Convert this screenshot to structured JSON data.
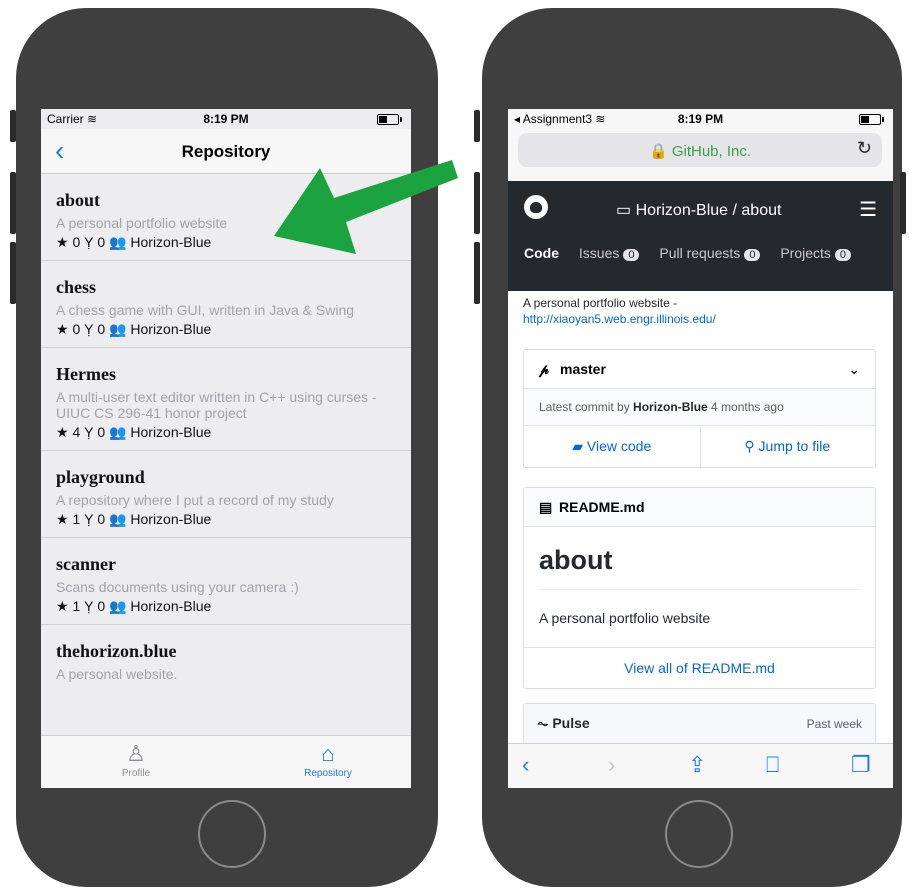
{
  "left": {
    "status": {
      "carrier": "Carrier",
      "time": "8:19 PM"
    },
    "nav": {
      "back": "‹",
      "title": "Repository"
    },
    "repos": [
      {
        "name": "about",
        "desc": "A personal portfolio website",
        "stars": "0",
        "forks": "0",
        "owner": "Horizon-Blue"
      },
      {
        "name": "chess",
        "desc": "A chess game with GUI, written in Java & Swing",
        "stars": "0",
        "forks": "0",
        "owner": "Horizon-Blue"
      },
      {
        "name": "Hermes",
        "desc": "A multi-user text editor written in C++ using curses - UIUC CS 296-41 honor project",
        "stars": "4",
        "forks": "0",
        "owner": "Horizon-Blue"
      },
      {
        "name": "playground",
        "desc": "A repository where I put a record of my study",
        "stars": "1",
        "forks": "0",
        "owner": "Horizon-Blue"
      },
      {
        "name": "scanner",
        "desc": "Scans documents using your camera :)",
        "stars": "1",
        "forks": "0",
        "owner": "Horizon-Blue"
      },
      {
        "name": "thehorizon.blue",
        "desc": "A personal website.",
        "stars": "",
        "forks": "",
        "owner": ""
      }
    ],
    "tabs": {
      "profile": "Profile",
      "repository": "Repository"
    },
    "colors": {
      "tint": "#1b7cf6",
      "selected_tab": "#1b7cf6"
    }
  },
  "right": {
    "status": {
      "carrier": "Assignment3",
      "time": "8:19 PM"
    },
    "url": "GitHub, Inc.",
    "header": {
      "repo": "Horizon-Blue / about"
    },
    "tabs": [
      {
        "label": "Code",
        "count": ""
      },
      {
        "label": "Issues",
        "count": "0"
      },
      {
        "label": "Pull requests",
        "count": "0"
      },
      {
        "label": "Projects",
        "count": "0"
      }
    ],
    "description": "A personal portfolio website -",
    "homepage": "http://xiaoyan5.web.engr.illinois.edu/",
    "branch": "master",
    "commit": {
      "prefix": "Latest commit by ",
      "author": "Horizon-Blue",
      "suffix": " 4 months ago"
    },
    "buttons": {
      "view_code": "View code",
      "jump": "Jump to file"
    },
    "readme": {
      "file": "README.md",
      "heading": "about",
      "body": "A personal portfolio website",
      "view_all": "View all of README.md"
    },
    "pulse": {
      "label": "Pulse",
      "range": "Past week"
    },
    "colors": {
      "header_bg": "#24292e",
      "link": "#0366d6",
      "lock_green": "#3aa14a"
    }
  },
  "annotation": {
    "arrow_color": "#1aa33f"
  }
}
